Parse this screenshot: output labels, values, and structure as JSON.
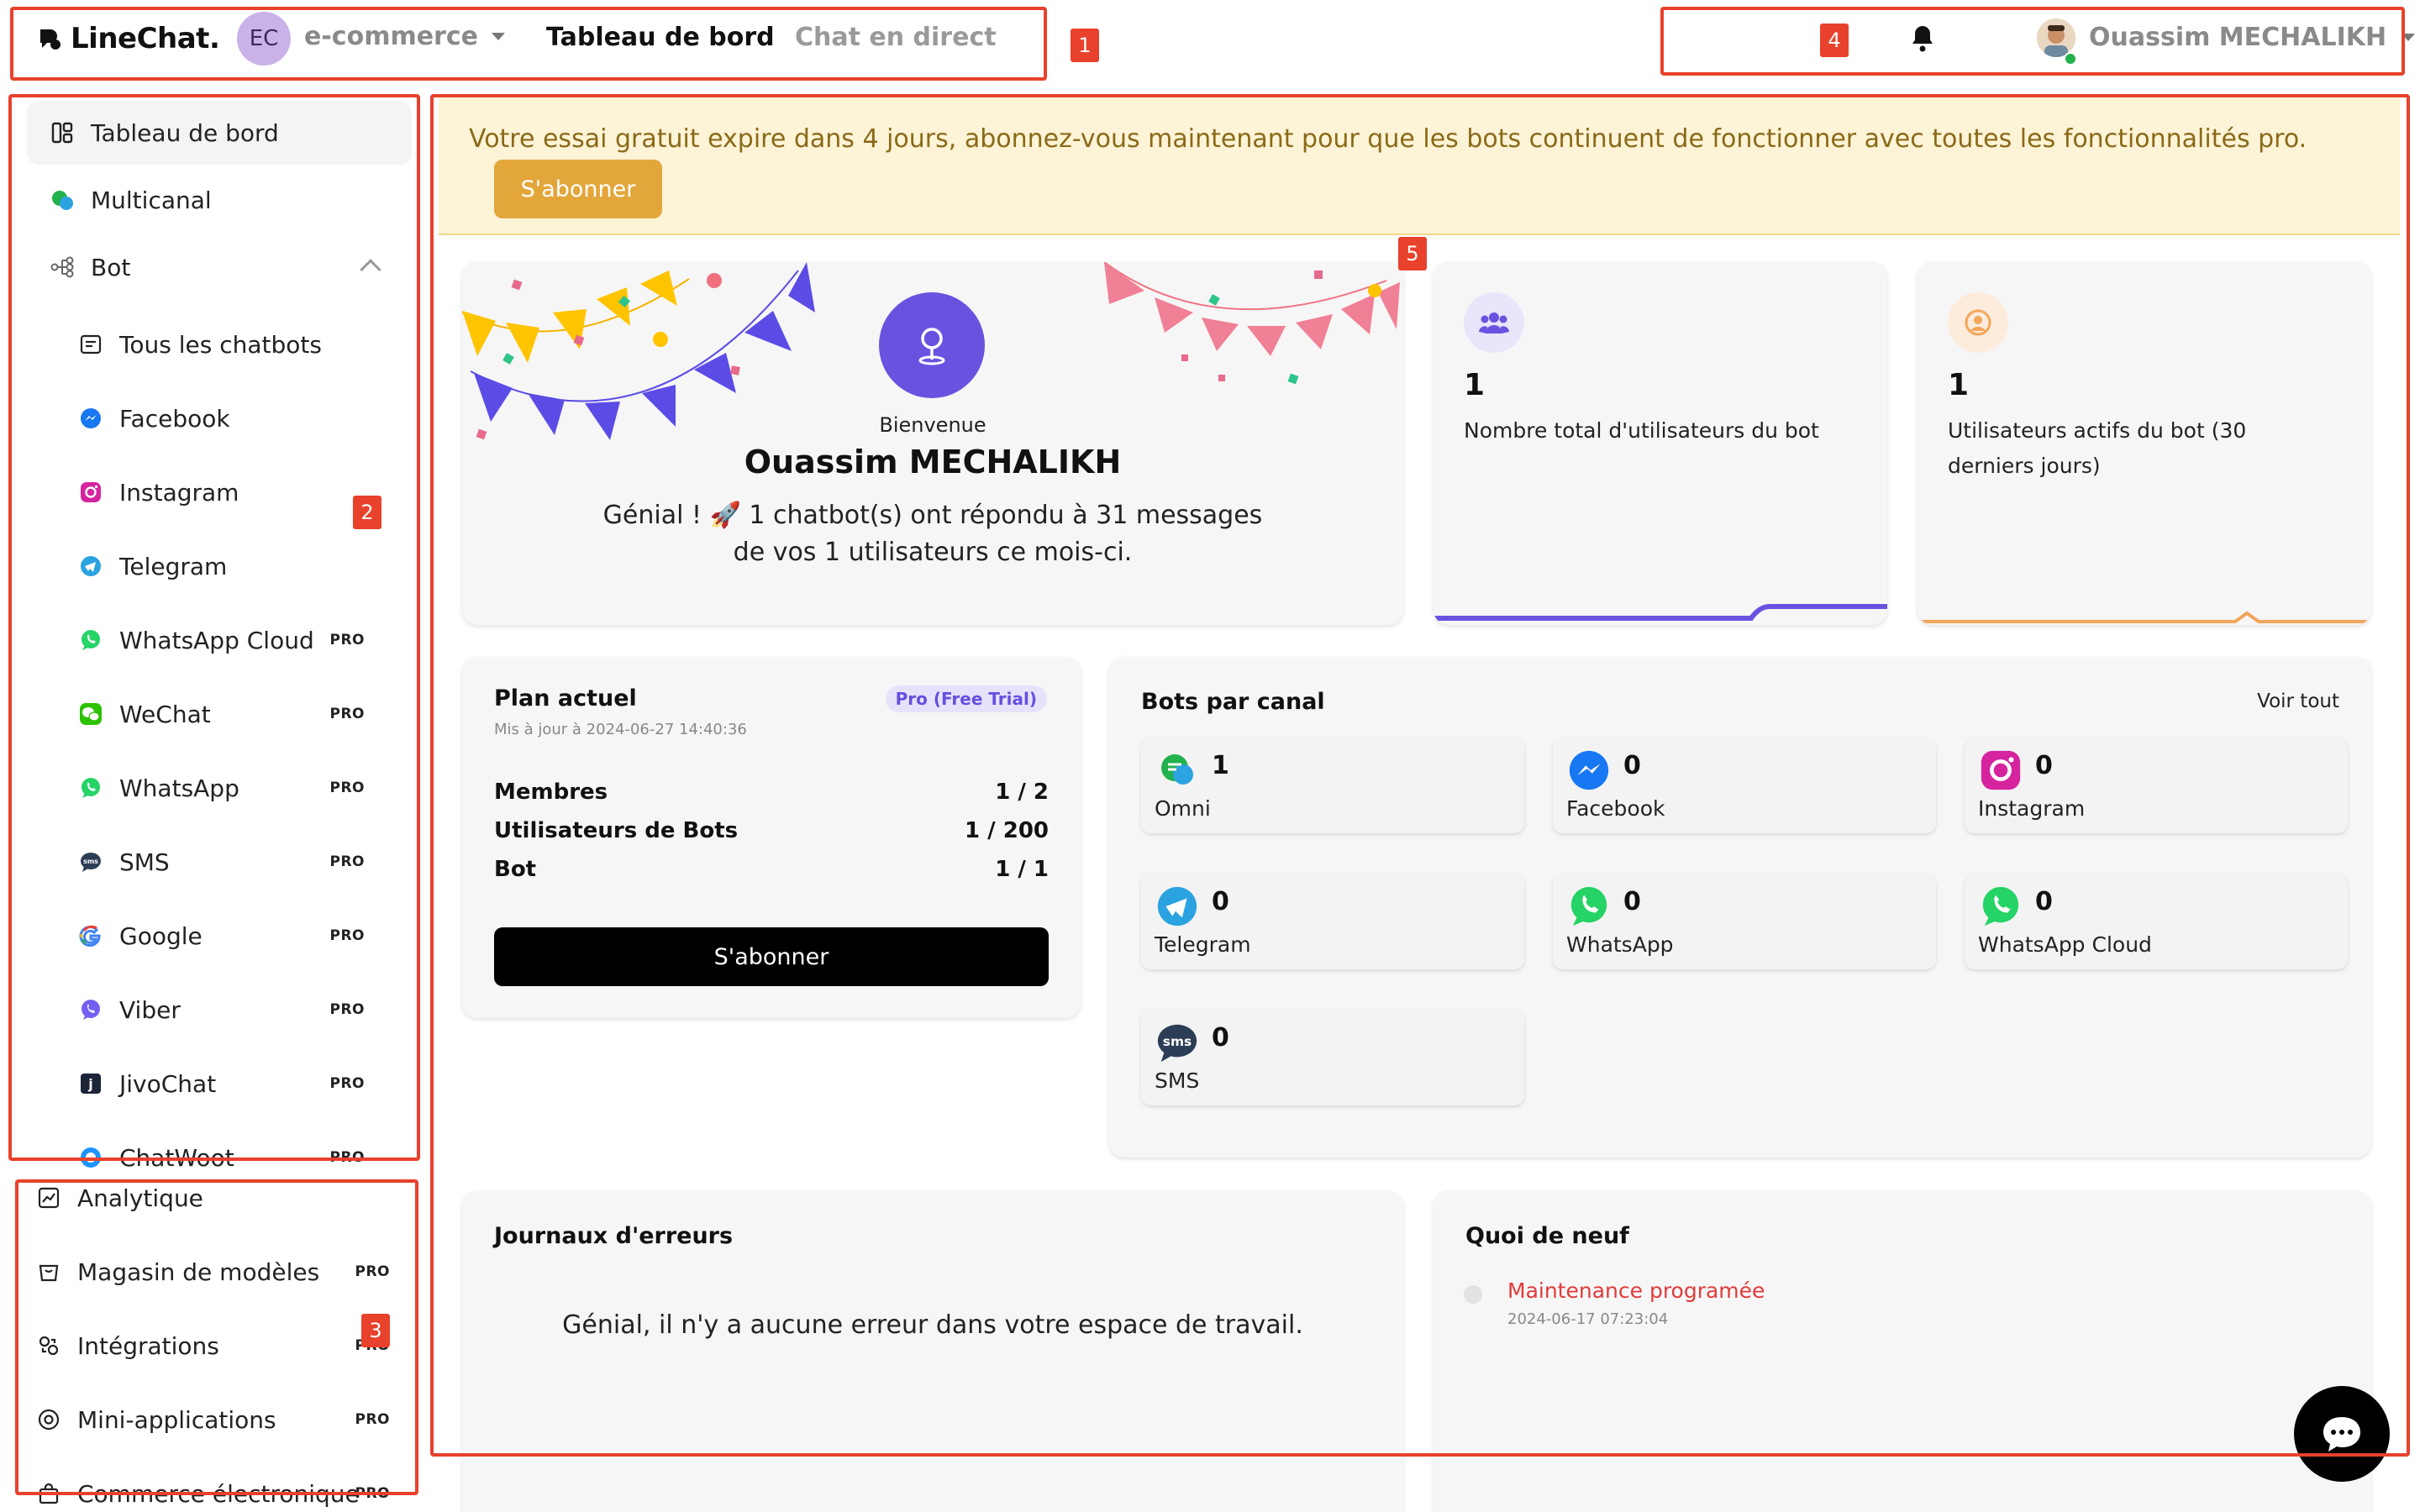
{
  "header": {
    "logo_text": "LineChat.",
    "workspace_initials": "EC",
    "workspace_name": "e-commerce",
    "tabs": [
      {
        "label": "Tableau de bord",
        "active": true
      },
      {
        "label": "Chat en direct",
        "active": false
      }
    ],
    "user_name": "Ouassim MECHALIKH"
  },
  "annotations": [
    "1",
    "2",
    "3",
    "4",
    "5"
  ],
  "sidebar": {
    "dashboard": "Tableau de bord",
    "multichannel": "Multicanal",
    "bot": "Bot",
    "bot_children": [
      {
        "label": "Tous les chatbots",
        "icon": "list-icon",
        "pro": ""
      },
      {
        "label": "Facebook",
        "icon": "messenger-icon",
        "pro": ""
      },
      {
        "label": "Instagram",
        "icon": "instagram-icon",
        "pro": ""
      },
      {
        "label": "Telegram",
        "icon": "telegram-icon",
        "pro": ""
      },
      {
        "label": "WhatsApp Cloud",
        "icon": "whatsapp-icon",
        "pro": "PRO"
      },
      {
        "label": "WeChat",
        "icon": "wechat-icon",
        "pro": "PRO"
      },
      {
        "label": "WhatsApp",
        "icon": "whatsapp-icon",
        "pro": "PRO"
      },
      {
        "label": "SMS",
        "icon": "sms-icon",
        "pro": "PRO"
      },
      {
        "label": "Google",
        "icon": "google-icon",
        "pro": "PRO"
      },
      {
        "label": "Viber",
        "icon": "viber-icon",
        "pro": "PRO"
      },
      {
        "label": "JivoChat",
        "icon": "jivochat-icon",
        "pro": "PRO"
      },
      {
        "label": "ChatWoot",
        "icon": "chatwoot-icon",
        "pro": "PRO"
      }
    ],
    "bottom_items": [
      {
        "label": "Analytique",
        "icon": "analytics-icon",
        "pro": ""
      },
      {
        "label": "Magasin de modèles",
        "icon": "store-icon",
        "pro": "PRO"
      },
      {
        "label": "Intégrations",
        "icon": "integrations-icon",
        "pro": "PRO"
      },
      {
        "label": "Mini-applications",
        "icon": "mini-apps-icon",
        "pro": "PRO"
      },
      {
        "label": "Commerce électronique",
        "icon": "shopping-bag-icon",
        "pro": "PRO"
      }
    ]
  },
  "banner": {
    "text": "Votre essai gratuit expire dans 4 jours, abonnez-vous maintenant pour que les bots continuent de fonctionner avec toutes les fonctionnalités pro.",
    "button": "S'abonner"
  },
  "welcome": {
    "greeting": "Bienvenue",
    "name": "Ouassim MECHALIKH",
    "message": "Génial ! 🚀 1 chatbot(s) ont répondu à 31 messages de vos 1 utilisateurs ce mois-ci."
  },
  "stats": [
    {
      "value": "1",
      "label": "Nombre total d'utilisateurs du bot",
      "color": "#6a52e0"
    },
    {
      "value": "1",
      "label": "Utilisateurs actifs du bot (30 derniers jours)",
      "color": "#f2a65a"
    }
  ],
  "plan": {
    "title": "Plan actuel",
    "badge": "Pro (Free Trial)",
    "updated": "Mis à jour à 2024-06-27 14:40:36",
    "rows": [
      {
        "label": "Membres",
        "value": "1 / 2"
      },
      {
        "label": "Utilisateurs de Bots",
        "value": "1 / 200"
      },
      {
        "label": "Bot",
        "value": "1 / 1"
      }
    ],
    "button": "S'abonner"
  },
  "bots_by_channel": {
    "title": "Bots par canal",
    "link": "Voir tout",
    "channels": [
      {
        "name": "Omni",
        "count": "1",
        "color": "#22b14c"
      },
      {
        "name": "Facebook",
        "count": "0",
        "color": "#1877f2"
      },
      {
        "name": "Instagram",
        "count": "0",
        "color": "#d6249f"
      },
      {
        "name": "Telegram",
        "count": "0",
        "color": "#2aa3e0"
      },
      {
        "name": "WhatsApp",
        "count": "0",
        "color": "#25d366"
      },
      {
        "name": "WhatsApp Cloud",
        "count": "0",
        "color": "#25d366"
      },
      {
        "name": "SMS",
        "count": "0",
        "color": "#2c3e55"
      }
    ]
  },
  "errors": {
    "title": "Journaux d'erreurs",
    "message": "Génial, il n'y a aucune erreur dans votre espace de travail."
  },
  "news": {
    "title": "Quoi de neuf",
    "items": [
      {
        "title": "Maintenance programée",
        "date": "2024-06-17 07:23:04"
      }
    ]
  },
  "colors": {
    "accent": "#6a52e0",
    "annotation": "#e8412c",
    "banner_bg": "#fdf3d6",
    "subscribe_orange": "#e3a63a"
  }
}
